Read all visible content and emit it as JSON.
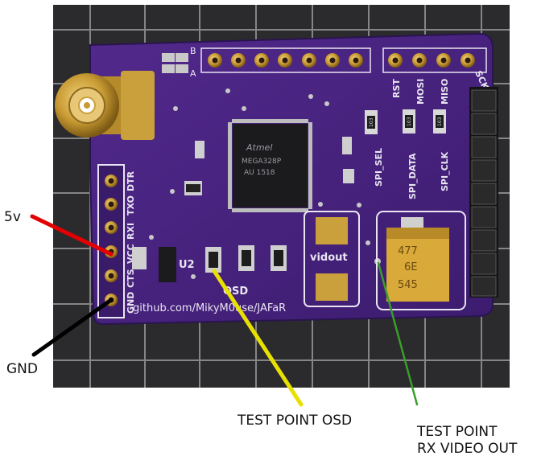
{
  "labels": {
    "five_v": "5v",
    "gnd": "GND",
    "test_point_osd": "TEST POINT OSD",
    "test_point_rx_line1": "TEST POINT",
    "test_point_rx_line2": "RX VIDEO OUT"
  },
  "silkscreen": {
    "header_left": [
      "GND",
      "CTS",
      "VCC",
      "RXI",
      "TXO",
      "DTR"
    ],
    "spi_pins": [
      "RST",
      "MOSI",
      "MISO",
      "SCK"
    ],
    "spi_signals": [
      "SPI_SEL",
      "SPI_DATA",
      "SPI_CLK"
    ],
    "chip_lines": [
      "Atmel",
      "MEGA328P",
      "AU 1518"
    ],
    "ic_label": "U2",
    "osd_label": "OSD",
    "vidout_label": "vidout",
    "url": "github.com/MikyM0use/JAFaR",
    "pad_letters": [
      "B",
      "A"
    ],
    "resistor_codes": [
      "103",
      "103",
      "103"
    ],
    "cap_lines": [
      "477",
      "6E",
      "545"
    ]
  },
  "colors": {
    "background": "#ffffff",
    "pcb": "#4a2580",
    "pcb_dark": "#3a1b6a",
    "silkscreen": "#e9e4f2",
    "gold": "#c8a040",
    "red_wire": "#e30000",
    "black_wire": "#000000",
    "yellow_wire": "#e8e000",
    "green_wire": "#3a9e2a",
    "capacitor": "#d9a93a"
  }
}
